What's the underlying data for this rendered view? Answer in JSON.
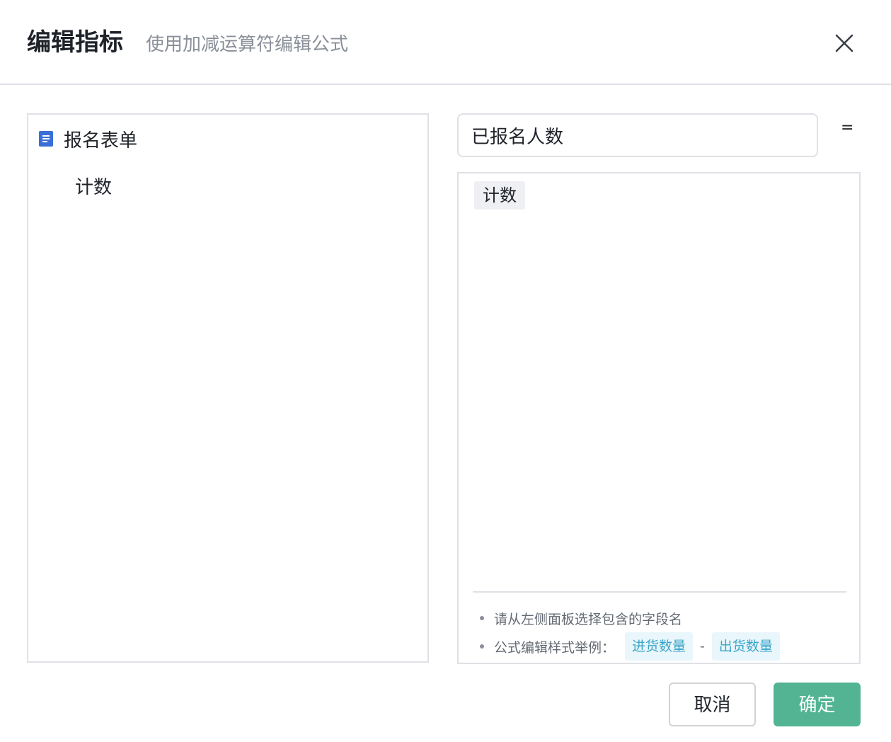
{
  "header": {
    "title": "编辑指标",
    "subtitle": "使用加减运算符编辑公式"
  },
  "left_panel": {
    "form_name": "报名表单",
    "fields": [
      "计数"
    ]
  },
  "formula": {
    "name_value": "已报名人数",
    "equals": "=",
    "tokens": [
      "计数"
    ],
    "tips": {
      "tip1": "请从左侧面板选择包含的字段名",
      "tip2_prefix": "公式编辑样式举例：",
      "example_a": "进货数量",
      "operator": "-",
      "example_b": "出货数量"
    }
  },
  "footer": {
    "cancel_label": "取消",
    "ok_label": "确定"
  },
  "colors": {
    "primary_button": "#52b493",
    "chip_text": "#3aa6c9",
    "chip_bg": "#e9f6fb",
    "doc_icon": "#3b6fd8"
  }
}
